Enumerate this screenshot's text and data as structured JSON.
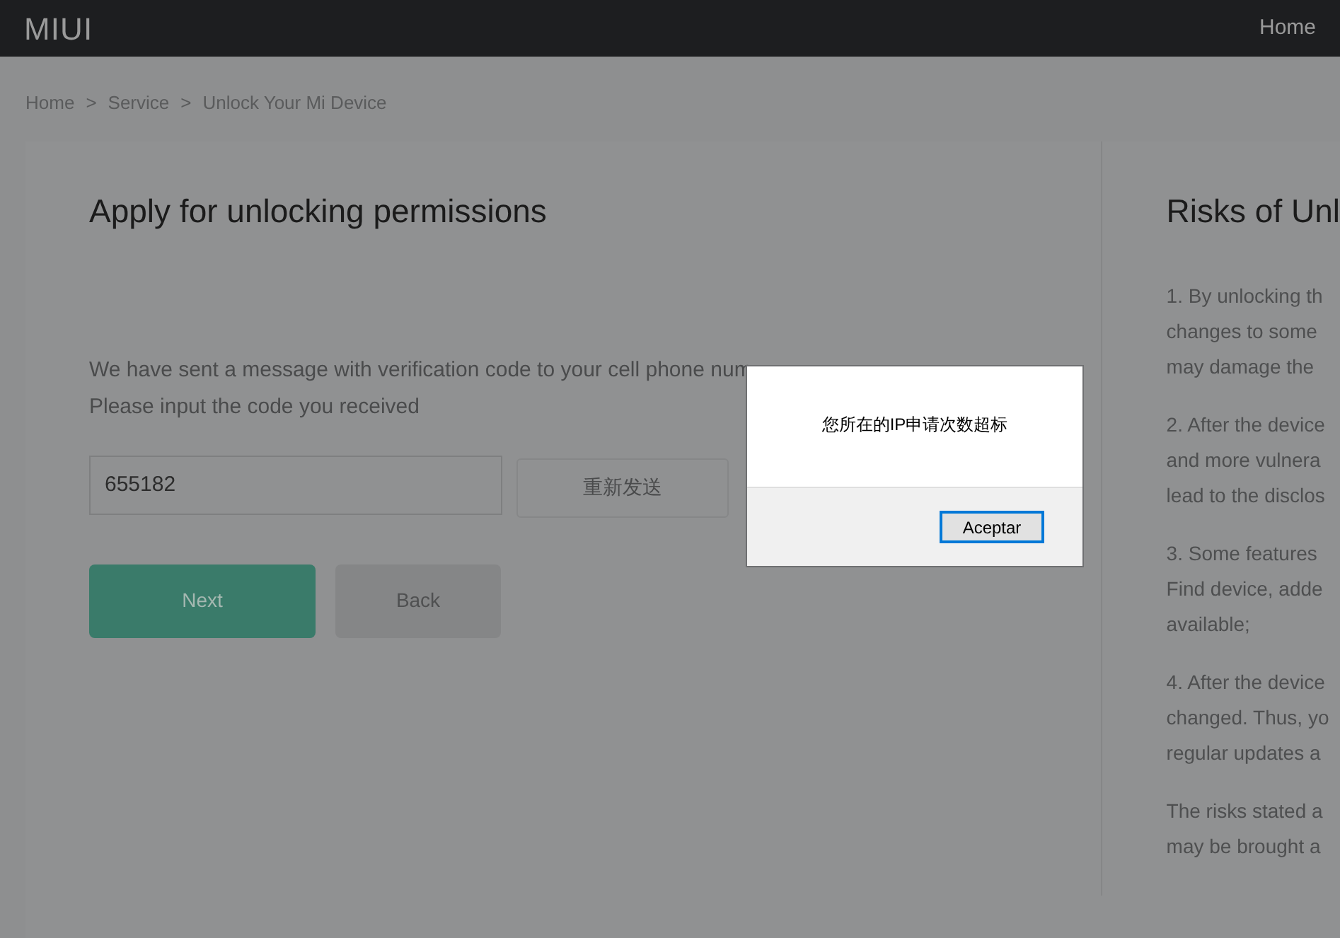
{
  "header": {
    "logo": "MIUI",
    "nav": [
      "Home"
    ]
  },
  "breadcrumb": [
    {
      "label": "Home"
    },
    {
      "label": ">"
    },
    {
      "label": "Service"
    },
    {
      "label": ">"
    },
    {
      "label": "Unlock Your Mi Device"
    }
  ],
  "form": {
    "title": "Apply for unlocking permissions",
    "message_lines": [
      "We have sent a message with verification code to your cell phone num",
      "Please input the code you received"
    ],
    "code_field": {
      "value": "655182"
    },
    "resend_button": "重新发送",
    "buttons": [
      {
        "label": "Next",
        "kind": "primary"
      },
      {
        "label": "Back",
        "kind": "secondary"
      }
    ]
  },
  "risks": {
    "title": "Risks of Unl",
    "paragraphs": [
      [
        "1. By unlocking th",
        "changes to some",
        "may damage the"
      ],
      [
        "2. After the device",
        "and more vulnera",
        "lead to the disclos"
      ],
      [
        "3. Some features",
        "Find device, adde",
        "available;"
      ],
      [
        "4. After the device",
        "changed. Thus, yo",
        "regular updates a"
      ],
      [
        "The risks stated a",
        "may be brought a"
      ]
    ]
  },
  "dialog": {
    "message": "您所在的IP申请次数超标",
    "button": "Aceptar"
  }
}
